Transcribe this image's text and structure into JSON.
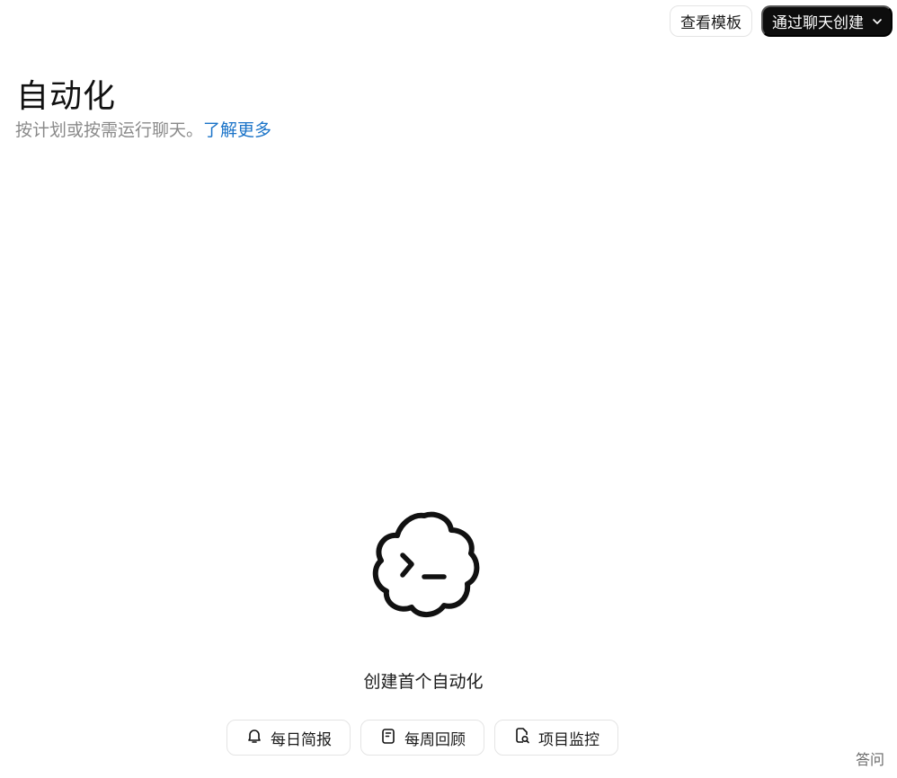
{
  "header": {
    "templates_button": "查看模板",
    "create_button": "通过聊天创建"
  },
  "page": {
    "title": "自动化",
    "subtitle": "按计划或按需运行聊天。",
    "learn_more": "了解更多"
  },
  "empty_state": {
    "title": "创建首个自动化",
    "chips": [
      {
        "label": "每日简报",
        "icon": "bell-icon"
      },
      {
        "label": "每周回顾",
        "icon": "notepad-icon"
      },
      {
        "label": "项目监控",
        "icon": "file-search-icon"
      }
    ]
  },
  "footer": {
    "corner_text": "答问"
  }
}
